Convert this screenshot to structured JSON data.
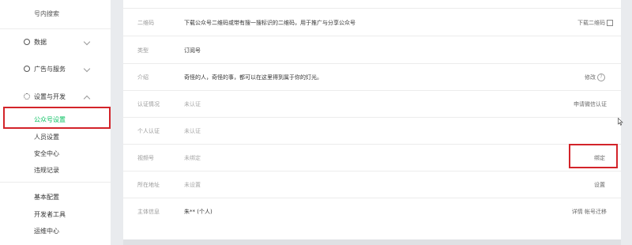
{
  "sidebar": {
    "top_item": "号内搜索",
    "sections": [
      {
        "label": "数据"
      },
      {
        "label": "广告与服务"
      },
      {
        "label": "设置与开发"
      }
    ],
    "settings_items": [
      {
        "label": "公众号设置"
      },
      {
        "label": "人员设置"
      },
      {
        "label": "安全中心"
      },
      {
        "label": "违规记录"
      }
    ],
    "dev_items": [
      {
        "label": "基本配置"
      },
      {
        "label": "开发者工具"
      },
      {
        "label": "运维中心"
      }
    ]
  },
  "settings": {
    "rows": [
      {
        "label": "二维码",
        "value": "下载公众号二维码或带有搜一搜标识的二维码，用于推广与分享公众号",
        "action": "下载二维码"
      },
      {
        "label": "类型",
        "value": "订阅号",
        "action": ""
      },
      {
        "label": "介绍",
        "value": "奇怪的人，奇怪的事，都可以在这里得到属于你的灯光。",
        "action": "修改"
      },
      {
        "label": "认证情况",
        "value": "未认证",
        "action": "申请微信认证"
      },
      {
        "label": "个人认证",
        "value": "未认证",
        "action": ""
      },
      {
        "label": "视频号",
        "value": "未绑定",
        "action": "绑定"
      },
      {
        "label": "所在地址",
        "value": "未设置",
        "action": "设置"
      },
      {
        "label": "主体信息",
        "value": "朱** (个人)",
        "action": "详情 帐号迁移"
      }
    ]
  },
  "colors": {
    "accent_green": "#07c160",
    "highlight_red": "#d3242a"
  }
}
